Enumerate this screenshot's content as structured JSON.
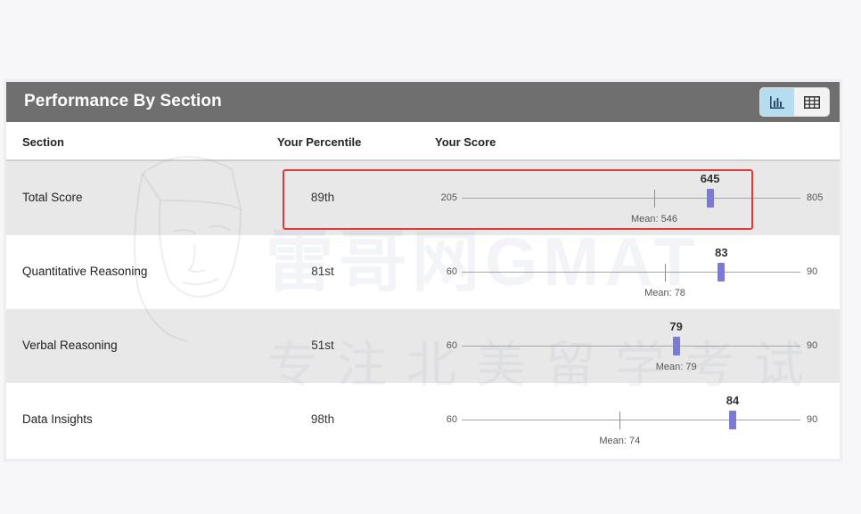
{
  "panel": {
    "title": "Performance By Section"
  },
  "columns": {
    "section": "Section",
    "percentile": "Your Percentile",
    "score": "Your Score"
  },
  "rows": [
    {
      "section": "Total Score",
      "percentile": "89th",
      "min": 205,
      "max": 805,
      "score": 645,
      "mean": 546,
      "mean_label": "Mean: 546",
      "min_label": "205",
      "max_label": "805",
      "score_label": "645"
    },
    {
      "section": "Quantitative Reasoning",
      "percentile": "81st",
      "min": 60,
      "max": 90,
      "score": 83,
      "mean": 78,
      "mean_label": "Mean: 78",
      "min_label": "60",
      "max_label": "90",
      "score_label": "83"
    },
    {
      "section": "Verbal Reasoning",
      "percentile": "51st",
      "min": 60,
      "max": 90,
      "score": 79,
      "mean": 79,
      "mean_label": "Mean: 79",
      "min_label": "60",
      "max_label": "90",
      "score_label": "79"
    },
    {
      "section": "Data Insights",
      "percentile": "98th",
      "min": 60,
      "max": 90,
      "score": 84,
      "mean": 74,
      "mean_label": "Mean: 74",
      "min_label": "60",
      "max_label": "90",
      "score_label": "84"
    }
  ],
  "watermark": {
    "logo": "雷哥网GMAT",
    "tagline": "专注北美留学考试"
  },
  "icons": {
    "chart_view": "bar-chart-icon",
    "table_view": "table-grid-icon"
  },
  "colors": {
    "header_bg": "#6f6f6f",
    "score_bar": "#7c7ad4",
    "highlight": "#e53935",
    "toggle_active": "#b4ddef"
  }
}
